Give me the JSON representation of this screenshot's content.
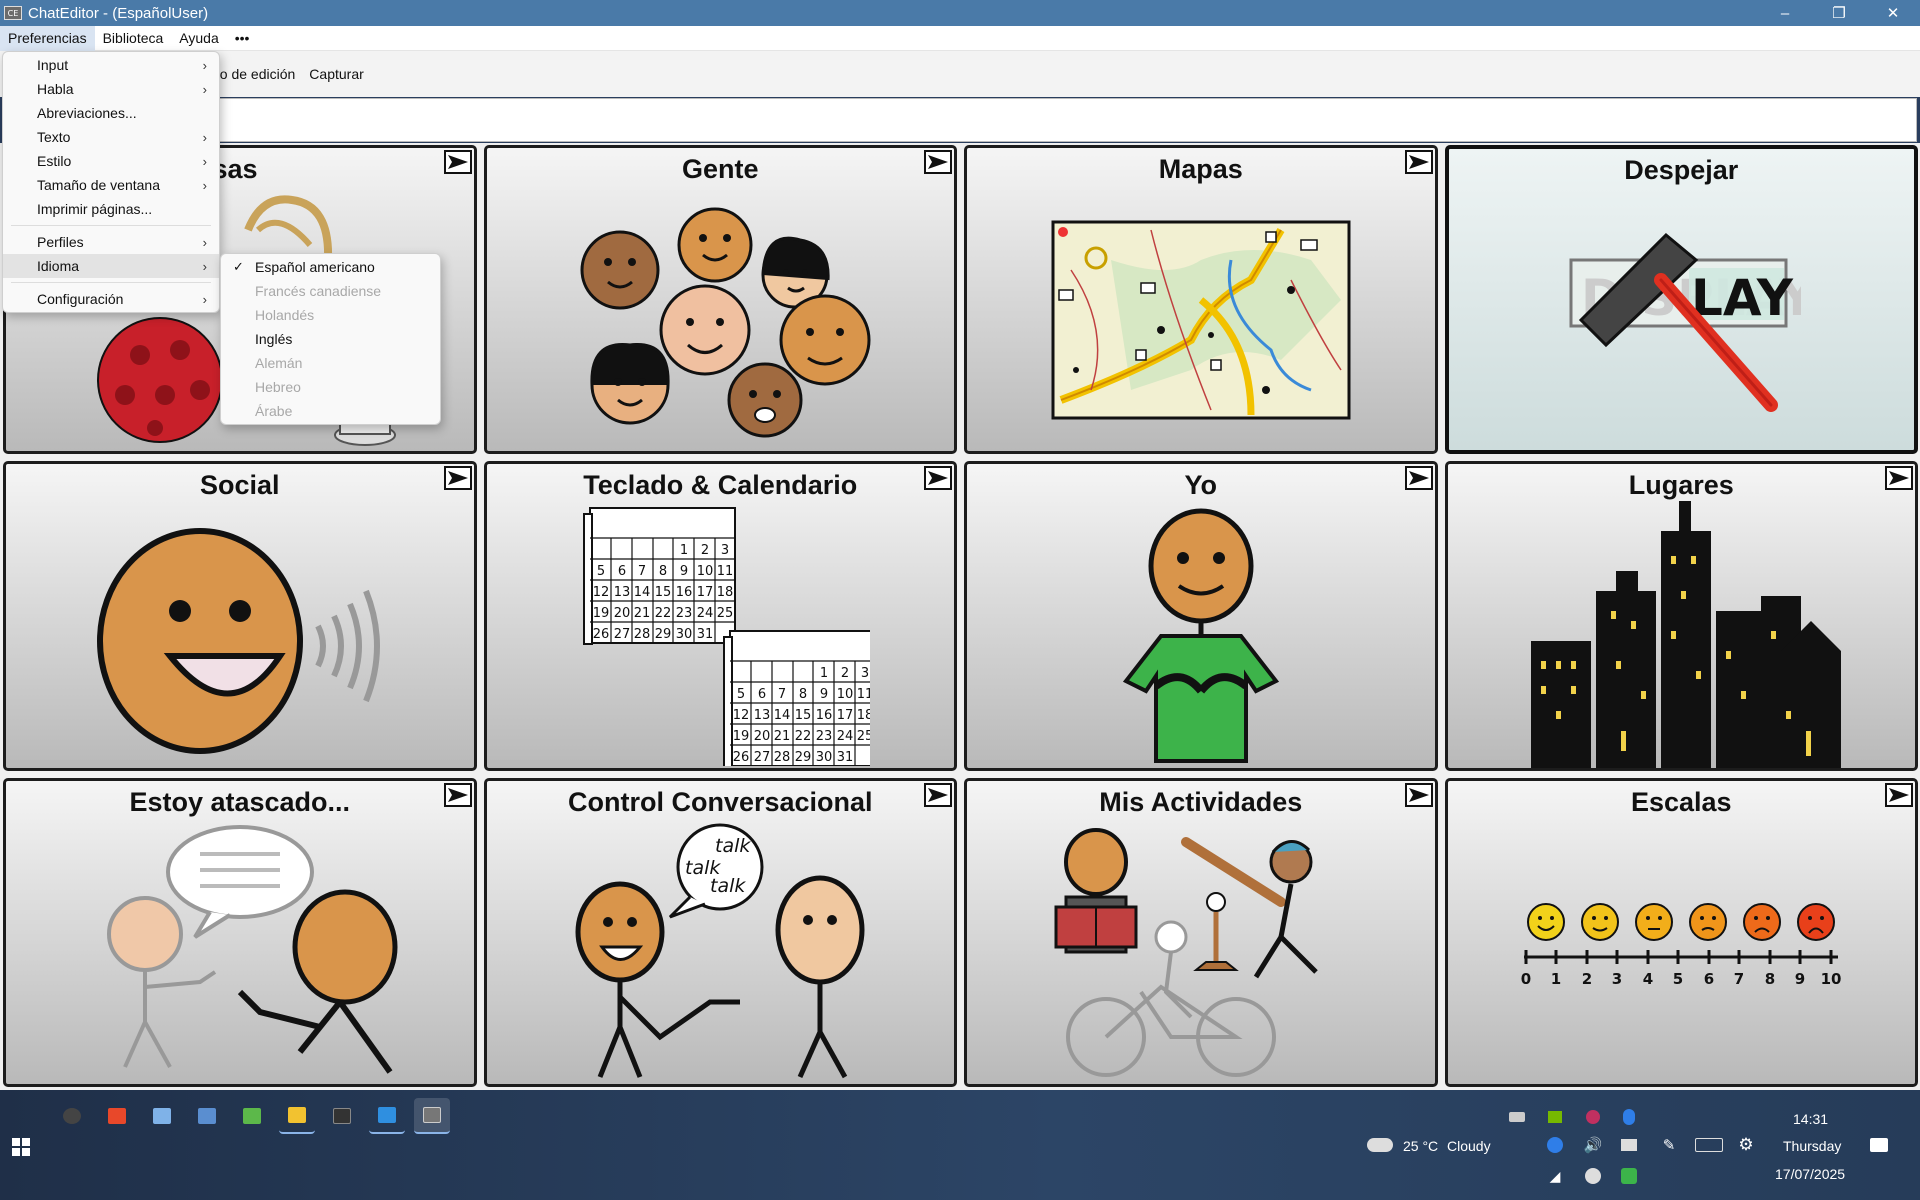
{
  "window": {
    "title": "ChatEditor - (EspañolUser)",
    "icon_text": "CE"
  },
  "menubar": {
    "items": [
      "Preferencias",
      "Biblioteca",
      "Ayuda",
      "•••"
    ]
  },
  "toolbar": {
    "items": [
      "do de edición",
      "Capturar"
    ]
  },
  "preferences_menu": {
    "items": [
      {
        "label": "Input",
        "submenu": true
      },
      {
        "label": "Habla",
        "submenu": true
      },
      {
        "label": "Abreviaciones...",
        "submenu": false
      },
      {
        "label": "Texto",
        "submenu": true
      },
      {
        "label": "Estilo",
        "submenu": true
      },
      {
        "label": "Tamaño de ventana",
        "submenu": true
      },
      {
        "label": "Imprimir páginas...",
        "submenu": false
      },
      {
        "label": "Perfiles",
        "submenu": true
      },
      {
        "label": "Idioma",
        "submenu": true,
        "highlighted": true
      },
      {
        "label": "Configuración",
        "submenu": true
      }
    ]
  },
  "language_menu": {
    "items": [
      {
        "label": "Español americano",
        "checked": true,
        "enabled": true
      },
      {
        "label": "Francés canadiense",
        "enabled": false
      },
      {
        "label": "Holandés",
        "enabled": false
      },
      {
        "label": "Inglés",
        "enabled": true
      },
      {
        "label": "Alemán",
        "enabled": false
      },
      {
        "label": "Hebreo",
        "enabled": false
      },
      {
        "label": "Árabe",
        "enabled": false
      }
    ]
  },
  "grid": {
    "cells": [
      {
        "label": "Cosas",
        "visible_label": "osas"
      },
      {
        "label": "Gente"
      },
      {
        "label": "Mapas"
      },
      {
        "label": "Despejar"
      },
      {
        "label": "Social"
      },
      {
        "label": "Teclado & Calendario"
      },
      {
        "label": "Yo"
      },
      {
        "label": "Lugares"
      },
      {
        "label": "Estoy atascado..."
      },
      {
        "label": "Control Conversacional"
      },
      {
        "label": "Mis Actividades"
      },
      {
        "label": "Escalas"
      }
    ],
    "scale_numbers": [
      "0",
      "1",
      "2",
      "3",
      "4",
      "5",
      "6",
      "7",
      "8",
      "9",
      "10"
    ],
    "talk_words": [
      "talk",
      "talk",
      "talk"
    ],
    "display_text": "DISPLAY"
  },
  "taskbar": {
    "weather": {
      "temp": "25 °C",
      "condition": "Cloudy"
    },
    "clock": {
      "time": "14:31",
      "day": "Thursday",
      "date": "17/07/2025"
    }
  },
  "colors": {
    "titlebar": "#4a7aa8",
    "skin": "#d9954b",
    "shirt_green": "#3db34a"
  }
}
